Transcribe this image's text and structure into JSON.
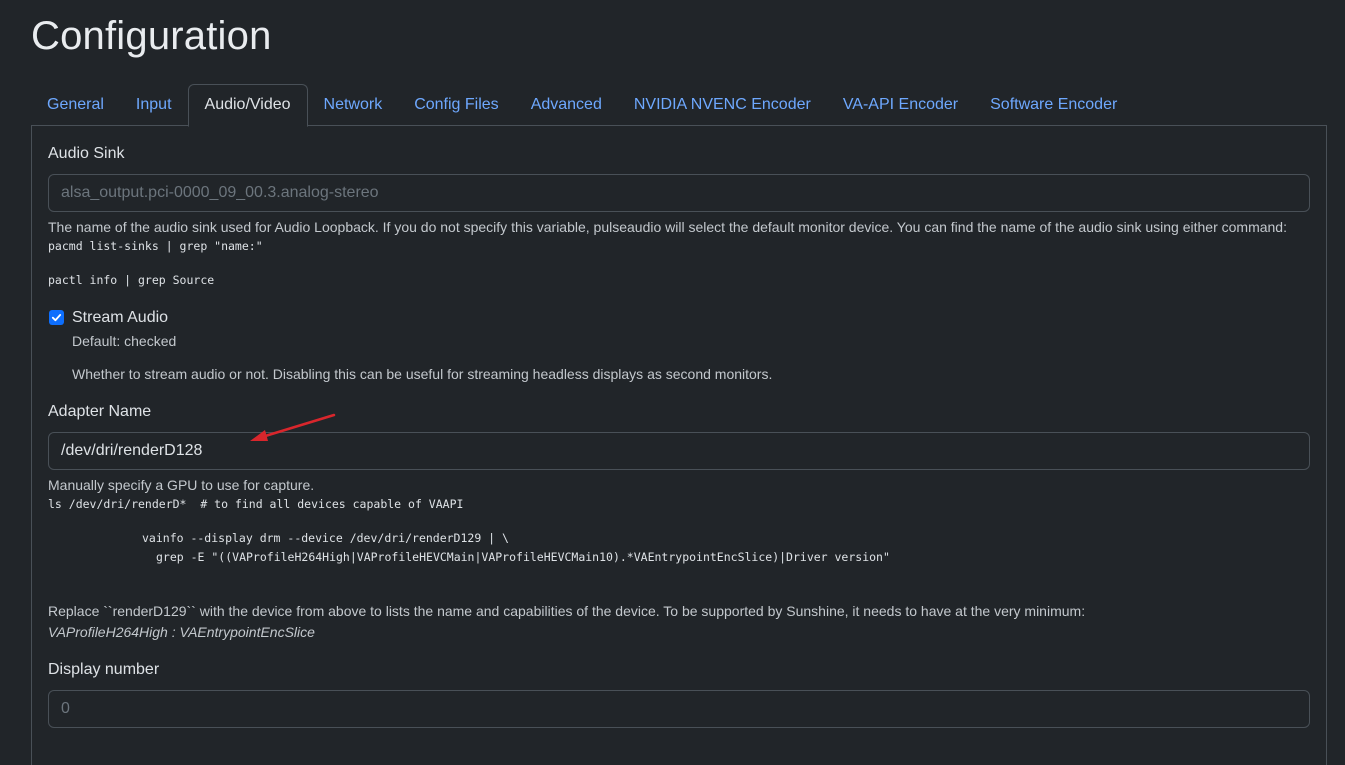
{
  "page": {
    "title": "Configuration"
  },
  "tabs": [
    {
      "label": "General"
    },
    {
      "label": "Input"
    },
    {
      "label": "Audio/Video"
    },
    {
      "label": "Network"
    },
    {
      "label": "Config Files"
    },
    {
      "label": "Advanced"
    },
    {
      "label": "NVIDIA NVENC Encoder"
    },
    {
      "label": "VA-API Encoder"
    },
    {
      "label": "Software Encoder"
    }
  ],
  "active_tab": "Audio/Video",
  "audio_sink": {
    "label": "Audio Sink",
    "placeholder": "alsa_output.pci-0000_09_00.3.analog-stereo",
    "value": "",
    "description": "The name of the audio sink used for Audio Loopback. If you do not specify this variable, pulseaudio will select the default monitor device. You can find the name of the audio sink using either command:",
    "command1": "pacmd list-sinks | grep \"name:\"",
    "command2": "pactl info | grep Source"
  },
  "stream_audio": {
    "label": "Stream Audio",
    "checked": true,
    "default_text": "Default: checked",
    "description": "Whether to stream audio or not. Disabling this can be useful for streaming headless displays as second monitors."
  },
  "adapter_name": {
    "label": "Adapter Name",
    "value": "/dev/dri/renderD128",
    "description": "Manually specify a GPU to use for capture.",
    "code_line1": "ls /dev/dri/renderD*  # to find all devices capable of VAAPI",
    "code_line2": "vainfo --display drm --device /dev/dri/renderD129 | \\",
    "code_line3": "grep -E \"((VAProfileH264High|VAProfileHEVCMain|VAProfileHEVCMain10).*VAEntrypointEncSlice)|Driver version\"",
    "note": "Replace ``renderD129`` with the device from above to lists the name and capabilities of the device. To be supported by Sunshine, it needs to have at the very minimum:",
    "requirement": "VAProfileH264High : VAEntrypointEncSlice"
  },
  "display_number": {
    "label": "Display number",
    "placeholder": "0",
    "value": ""
  },
  "colors": {
    "background": "#212529",
    "link": "#6ea8fe",
    "accent": "#0d6efd",
    "annotation_arrow": "#d9262c"
  },
  "icons": {
    "checkbox": "check-icon",
    "annotation": "red-arrow-icon"
  }
}
